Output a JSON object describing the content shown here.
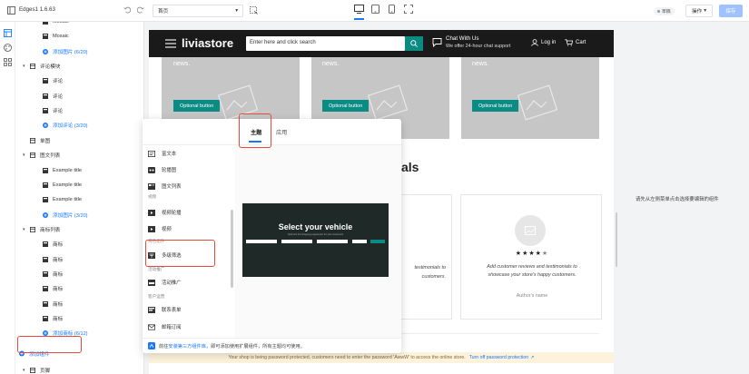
{
  "app": {
    "title": "Edges1 1.6.63"
  },
  "toolbar": {
    "page_select": "首页",
    "status_badge": "草稿",
    "actions_label": "操作",
    "save_label": "保存"
  },
  "tree": {
    "rows": [
      {
        "label": "Mosaic",
        "type": "item",
        "indent": 2
      },
      {
        "label": "Mosaic",
        "type": "item",
        "indent": 2
      },
      {
        "label": "添加图片 (6/20)",
        "type": "link",
        "indent": 2
      },
      {
        "label": "评论模块",
        "type": "group",
        "indent": 1
      },
      {
        "label": "评论",
        "type": "item",
        "indent": 2
      },
      {
        "label": "评论",
        "type": "item",
        "indent": 2
      },
      {
        "label": "评论",
        "type": "item",
        "indent": 2
      },
      {
        "label": "添加评论 (3/20)",
        "type": "link",
        "indent": 2
      },
      {
        "label": "单图",
        "type": "plain",
        "indent": 1
      },
      {
        "label": "图文列表",
        "type": "group",
        "indent": 1
      },
      {
        "label": "Example title",
        "type": "item",
        "indent": 2
      },
      {
        "label": "Example title",
        "type": "item",
        "indent": 2
      },
      {
        "label": "Example title",
        "type": "item",
        "indent": 2
      },
      {
        "label": "添加图片 (3/20)",
        "type": "link",
        "indent": 2
      },
      {
        "label": "商标列表",
        "type": "group",
        "indent": 1
      },
      {
        "label": "商标",
        "type": "item",
        "indent": 2
      },
      {
        "label": "商标",
        "type": "item",
        "indent": 2
      },
      {
        "label": "商标",
        "type": "item",
        "indent": 2
      },
      {
        "label": "商标",
        "type": "item",
        "indent": 2
      },
      {
        "label": "商标",
        "type": "item",
        "indent": 2
      },
      {
        "label": "商标",
        "type": "item",
        "indent": 2
      },
      {
        "label": "添加商标 (6/12)",
        "type": "link",
        "indent": 2
      },
      {
        "label": "添加组件",
        "type": "add",
        "indent": 0
      },
      {
        "label": "页脚",
        "type": "group",
        "indent": 0
      }
    ]
  },
  "store": {
    "logo": "liviastore",
    "search_placeholder": "Enter here and click search",
    "chat_title": "Chat With Us",
    "chat_sub": "We offer 24-hour chat support",
    "login": "Log in",
    "cart": "Cart",
    "news": "news.",
    "optional_button": "Optional button",
    "heading_tail": "als",
    "review_text": "Add customer reviews and testimonials to showcase your store's happy customers.",
    "review_text_partial_1": "testimonials to",
    "review_text_partial_2": "customers.",
    "author": "Author's name"
  },
  "popup": {
    "tabs": [
      "主题",
      "应用"
    ],
    "items": [
      {
        "label": "富文本",
        "section": null
      },
      {
        "label": "轮播图",
        "section": null
      },
      {
        "label": "图文列表",
        "section": null
      },
      {
        "label": "视频轮播",
        "section": "视频"
      },
      {
        "label": "视频",
        "section": null
      },
      {
        "label": "多级筛选",
        "section": "特色组件"
      },
      {
        "label": "活动推广",
        "section": "活动推广"
      },
      {
        "label": "联系表单",
        "section": "客户运营"
      },
      {
        "label": "邮箱订阅",
        "section": null
      }
    ],
    "preview_title": "Select your vehicle",
    "preview_sub": "Optimize the shopping experience for your customers",
    "footer_prefix": "前往",
    "footer_link": "安装第三方组件库",
    "footer_suffix": "，即可添加使用扩展组件，所有主题均可使用。"
  },
  "banner": {
    "text": "Your shop is being password protected, customers need to enter the password 'AwwW' to access the online store.",
    "link": "Turn off password protection"
  },
  "right_panel": {
    "hint": "请先从左侧菜单点击选择要编辑的组件"
  },
  "colors": {
    "accent": "#0a8b84",
    "link": "#1677ff",
    "highlight": "#e64a3b"
  }
}
